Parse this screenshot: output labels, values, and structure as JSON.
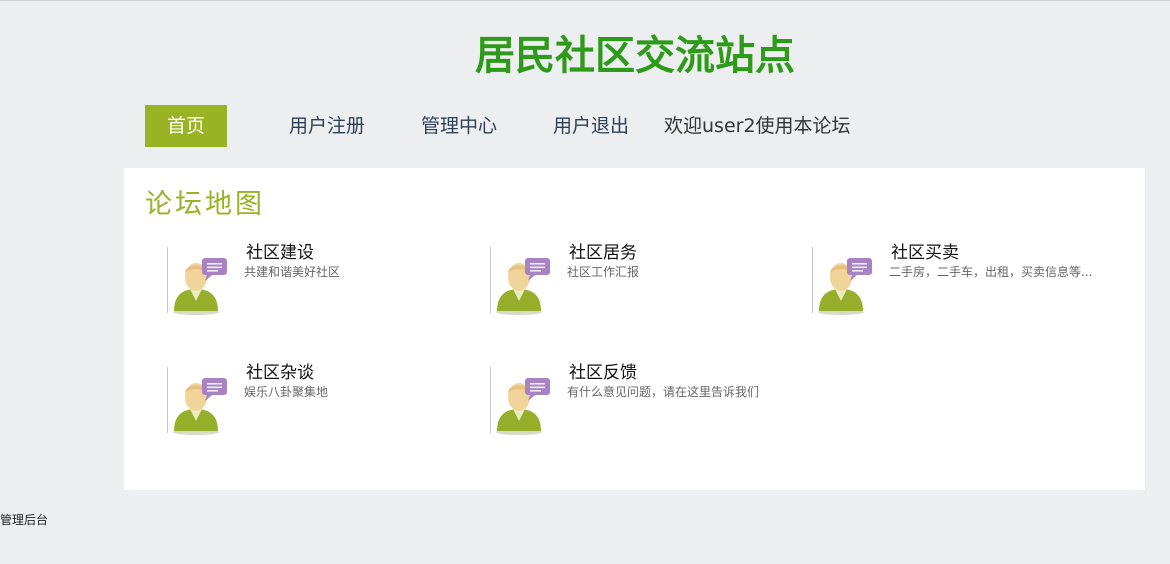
{
  "site": {
    "title": "居民社区交流站点"
  },
  "nav": {
    "home": "首页",
    "register": "用户注册",
    "admin_center": "管理中心",
    "logout": "用户退出",
    "welcome": "欢迎user2使用本论坛"
  },
  "panel": {
    "title": "论坛地图",
    "forums": [
      {
        "name": "社区建设",
        "desc": "共建和谐美好社区",
        "icon": "user-chat-icon"
      },
      {
        "name": "社区居务",
        "desc": "社区工作汇报",
        "icon": "user-chat-icon"
      },
      {
        "name": "社区买卖",
        "desc": "二手房，二手车，出租，买卖信息等...",
        "icon": "user-chat-icon"
      },
      {
        "name": "社区杂谈",
        "desc": "娱乐八卦聚集地",
        "icon": "user-chat-icon"
      },
      {
        "name": "社区反馈",
        "desc": "有什么意见问题，请在这里告诉我们",
        "icon": "user-chat-icon"
      }
    ]
  },
  "footer": {
    "admin_backend": "管理后台"
  },
  "colors": {
    "title_green": "#2e9a1a",
    "accent_olive": "#98b324",
    "background": "#edeef0",
    "panel_bg": "#ffffff"
  }
}
